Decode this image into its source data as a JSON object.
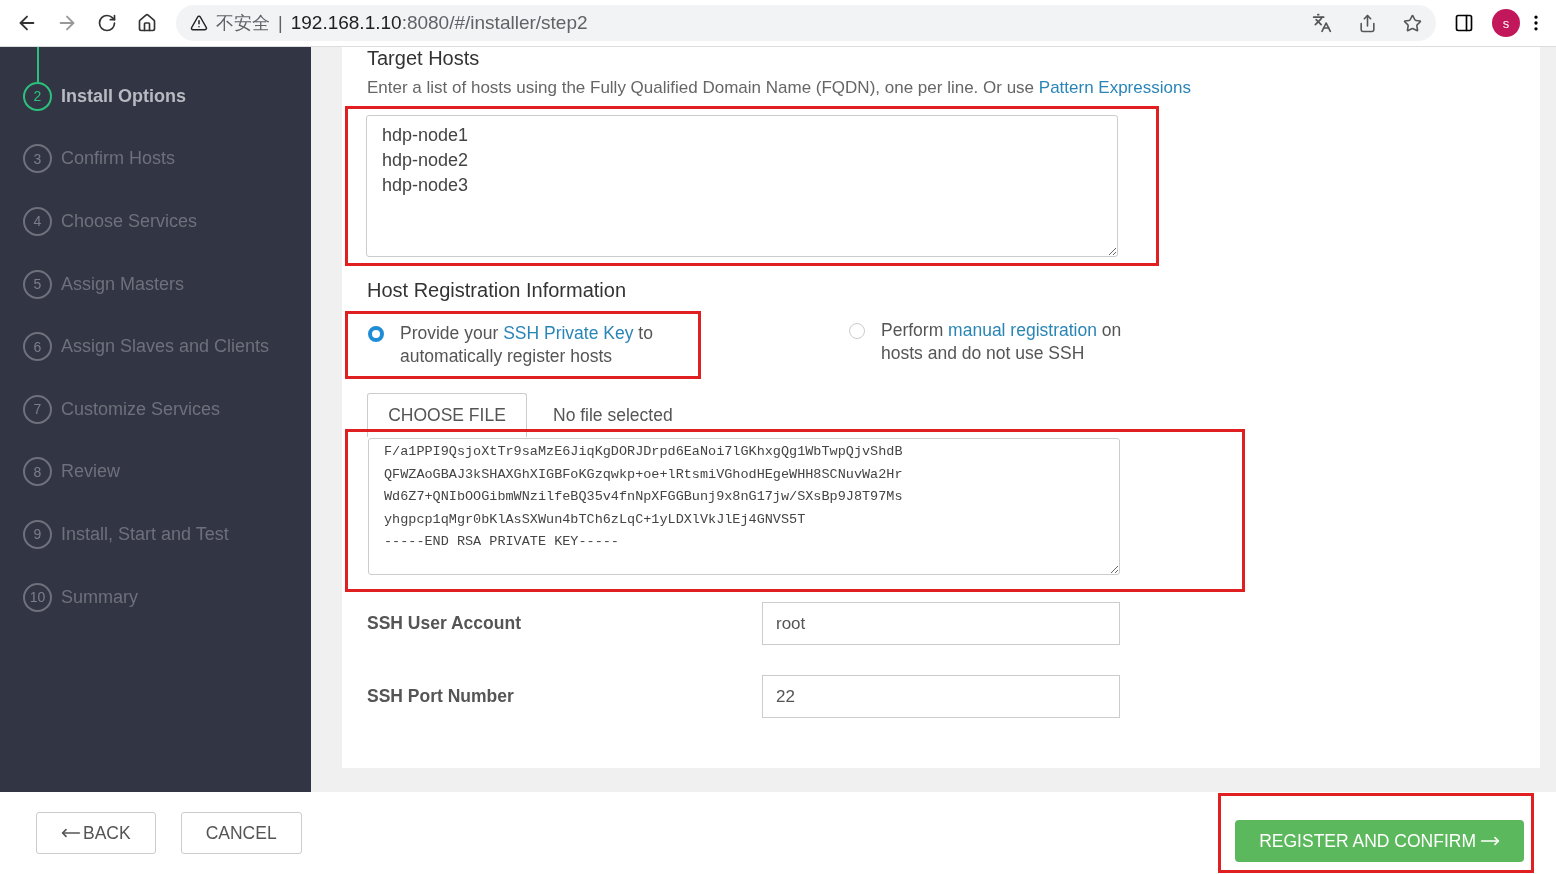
{
  "browser": {
    "security_label": "不安全",
    "separator": "|",
    "url_host": "192.168.1.10",
    "url_rest": ":8080/#/installer/step2",
    "avatar": "s"
  },
  "steps": [
    {
      "number": "2",
      "label": "Install Options",
      "selected": true
    },
    {
      "number": "3",
      "label": "Confirm Hosts",
      "selected": false
    },
    {
      "number": "4",
      "label": "Choose Services",
      "selected": false
    },
    {
      "number": "5",
      "label": "Assign Masters",
      "selected": false
    },
    {
      "number": "6",
      "label": "Assign Slaves and Clients",
      "selected": false
    },
    {
      "number": "7",
      "label": "Customize Services",
      "selected": false
    },
    {
      "number": "8",
      "label": "Review",
      "selected": false
    },
    {
      "number": "9",
      "label": "Install, Start and Test",
      "selected": false
    },
    {
      "number": "10",
      "label": "Summary",
      "selected": false
    }
  ],
  "target_hosts": {
    "title": "Target Hosts",
    "hint": "Enter a list of hosts using the Fully Qualified Domain Name (FQDN), one per line. Or use",
    "hint_link": "Pattern Expressions",
    "value": "hdp-node1\nhdp-node2\nhdp-node3"
  },
  "registration": {
    "title": "Host Registration Information",
    "options": [
      {
        "before": "Provide your",
        "link": "SSH Private Key",
        "after": "to automatically register hosts",
        "selected": true
      },
      {
        "before": "Perform",
        "link": "manual registration",
        "after": "on hosts and do not use SSH",
        "selected": false
      }
    ],
    "choose_file": "CHOOSE FILE",
    "file_status": "No file selected",
    "key_value": "F/a1PPI9QsjoXtTr9saMzE6JiqKgDORJDrpd6EaNoi7lGKhxgQg1WbTwpQjvShdB\nQFWZAoGBAJ3kSHAXGhXIGBFoKGzqwkp+oe+lRtsmiVGhodHEgeWHH8SCNuvWa2Hr\nWd6Z7+QNIbOOGibmWNzilfeBQ35v4fnNpXFGGBunj9x8nG17jw/SXsBp9J8T97Ms\nyhgpcp1qMgr0bKlAsSXWun4bTCh6zLqC+1yLDXlVkJlEj4GNVS5T\n-----END RSA PRIVATE KEY-----\n"
  },
  "fields": [
    {
      "label": "SSH User Account",
      "value": "root"
    },
    {
      "label": "SSH Port Number",
      "value": "22"
    }
  ],
  "footer": {
    "back": "BACK",
    "cancel": "CANCEL",
    "register": "REGISTER AND CONFIRM"
  }
}
